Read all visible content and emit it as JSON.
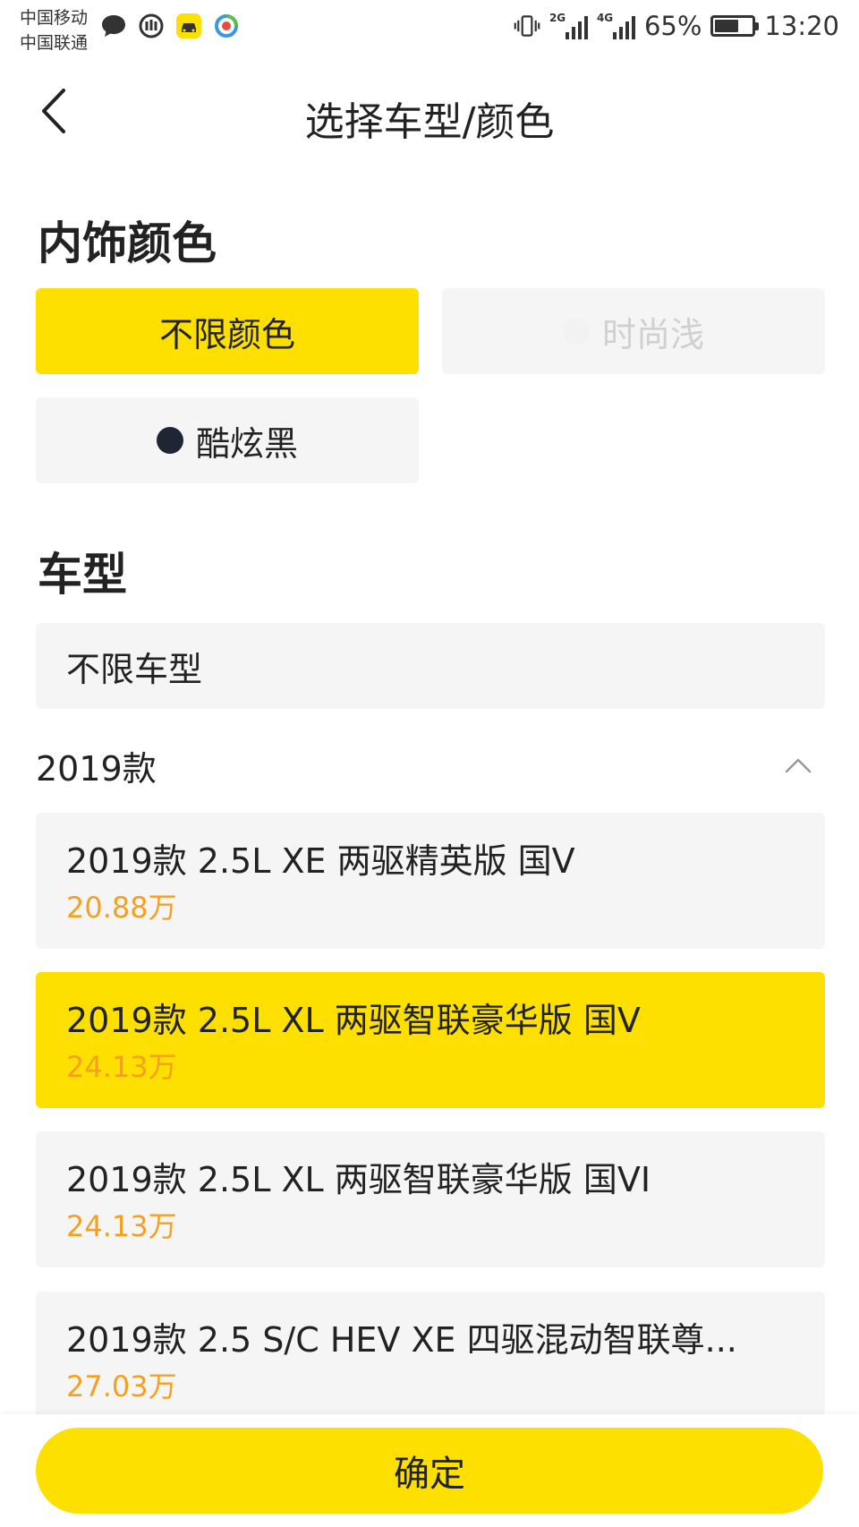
{
  "status_bar": {
    "carrier_1": "中国移动",
    "carrier_2": "中国联通",
    "left_icons": [
      "message-icon",
      "shield-app-icon",
      "car-app-icon",
      "camera-app-icon"
    ],
    "network_1": "2G",
    "network_2": "4G",
    "battery_percent": "65%",
    "battery_level": 0.65,
    "time": "13:20"
  },
  "nav": {
    "title": "选择车型/颜色",
    "back_icon": "chevron-left-icon"
  },
  "interior_color": {
    "title": "内饰颜色",
    "options": [
      {
        "label": "不限颜色",
        "selected": true,
        "disabled": false,
        "swatch": null
      },
      {
        "label": "时尚浅",
        "selected": false,
        "disabled": true,
        "swatch": "#f2f2f2"
      },
      {
        "label": "酷炫黑",
        "selected": false,
        "disabled": false,
        "swatch": "#1f2633"
      }
    ]
  },
  "model": {
    "title": "车型",
    "any_label": "不限车型",
    "year_group": "2019款",
    "items": [
      {
        "name": "2019款 2.5L XE 两驱精英版 国V",
        "price": "20.88万",
        "selected": false
      },
      {
        "name": "2019款 2.5L XL 两驱智联豪华版 国V",
        "price": "24.13万",
        "selected": true
      },
      {
        "name": "2019款 2.5L XL 两驱智联豪华版 国VI",
        "price": "24.13万",
        "selected": false
      },
      {
        "name": "2019款 2.5 S/C HEV XE 四驱混动智联尊...",
        "price": "27.03万",
        "selected": false
      }
    ]
  },
  "footer": {
    "confirm_label": "确定"
  },
  "colors": {
    "accent_yellow": "#fde000",
    "price_orange": "#f5a020",
    "chip_gray": "#f5f5f5"
  }
}
